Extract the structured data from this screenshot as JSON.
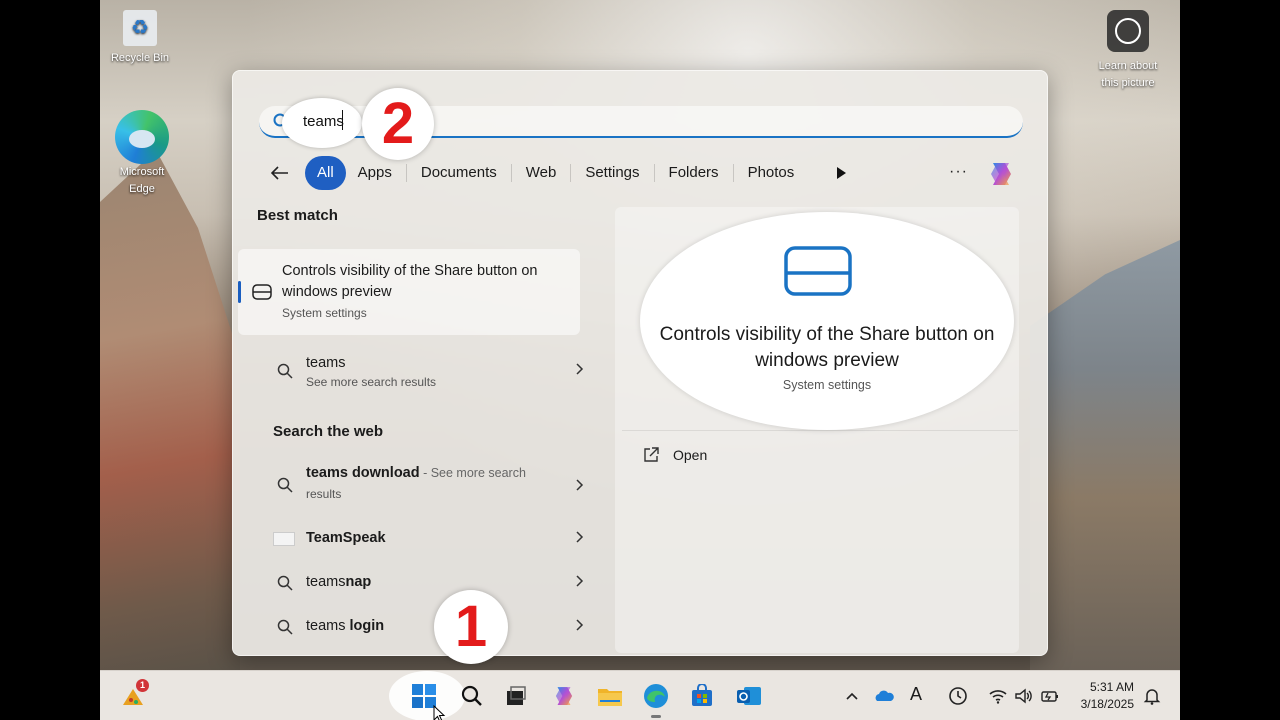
{
  "desktop": {
    "recycle_bin": "Recycle Bin",
    "edge": "Microsoft Edge",
    "learn_about": "Learn about this picture"
  },
  "search": {
    "value": "teams",
    "callout_search": "2",
    "callout_start": "1"
  },
  "filters": [
    "All",
    "Apps",
    "Documents",
    "Web",
    "Settings",
    "Folders",
    "Photos"
  ],
  "results": {
    "best_match_heading": "Best match",
    "best_match": {
      "title": "Controls visibility of the Share button on windows preview",
      "subtitle": "System settings"
    },
    "see_more": {
      "title": "teams",
      "subtitle": "See more search results"
    },
    "web_heading": "Search the web",
    "web_items": [
      {
        "title": "teams download",
        "suffix": " - See more search",
        "line2": "results"
      },
      {
        "title": "TeamSpeak"
      },
      {
        "prefix": "teams",
        "bold": "nap"
      },
      {
        "prefix": "teams",
        "bold": " login"
      }
    ]
  },
  "detail": {
    "title": "Controls visibility of the Share button on windows preview",
    "subtitle": "System settings",
    "open_label": "Open"
  },
  "taskbar": {
    "widget_badge": "1",
    "time": "5:31 AM",
    "date": "3/18/2025",
    "lang": "A"
  },
  "colors": {
    "accent": "#1f5fc2",
    "callout_red": "#e31b1b"
  }
}
